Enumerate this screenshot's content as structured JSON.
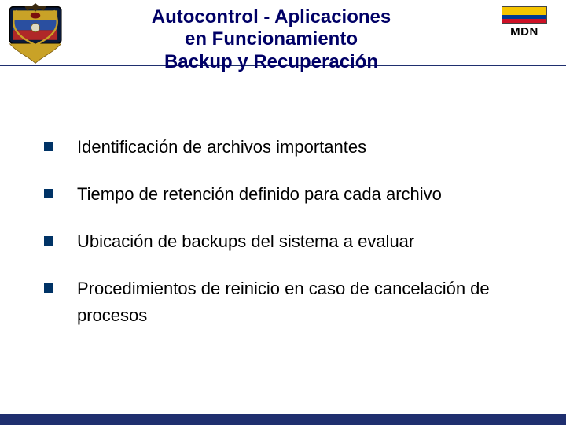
{
  "header": {
    "title_lines": [
      "Autocontrol - Aplicaciones",
      "en Funcionamiento",
      "Backup y Recuperación"
    ],
    "badge_label": "MDN"
  },
  "bullets": [
    "Identificación de archivos importantes",
    "Tiempo de retención definido para cada archivo",
    "Ubicación de backups del sistema a evaluar",
    "Procedimientos de reinicio en caso de cancelación de procesos"
  ],
  "colors": {
    "title_text": "#000066",
    "rule_bar": "#1f2f6f",
    "bullet_square": "#003366"
  }
}
